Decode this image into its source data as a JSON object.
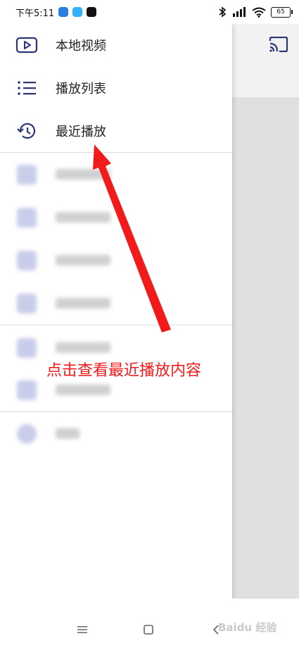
{
  "status_bar": {
    "time": "下午5:11",
    "battery": "65"
  },
  "drawer": {
    "items": [
      {
        "label": "本地视频",
        "icon": "video-play-icon"
      },
      {
        "label": "播放列表",
        "icon": "playlist-icon"
      },
      {
        "label": "最近播放",
        "icon": "history-icon"
      }
    ]
  },
  "annotation": {
    "text": "点击查看最近播放内容"
  },
  "watermark": {
    "text": "Baidu 经验"
  },
  "colors": {
    "accent": "#2b3577",
    "annotation_red": "#f21b1b"
  }
}
